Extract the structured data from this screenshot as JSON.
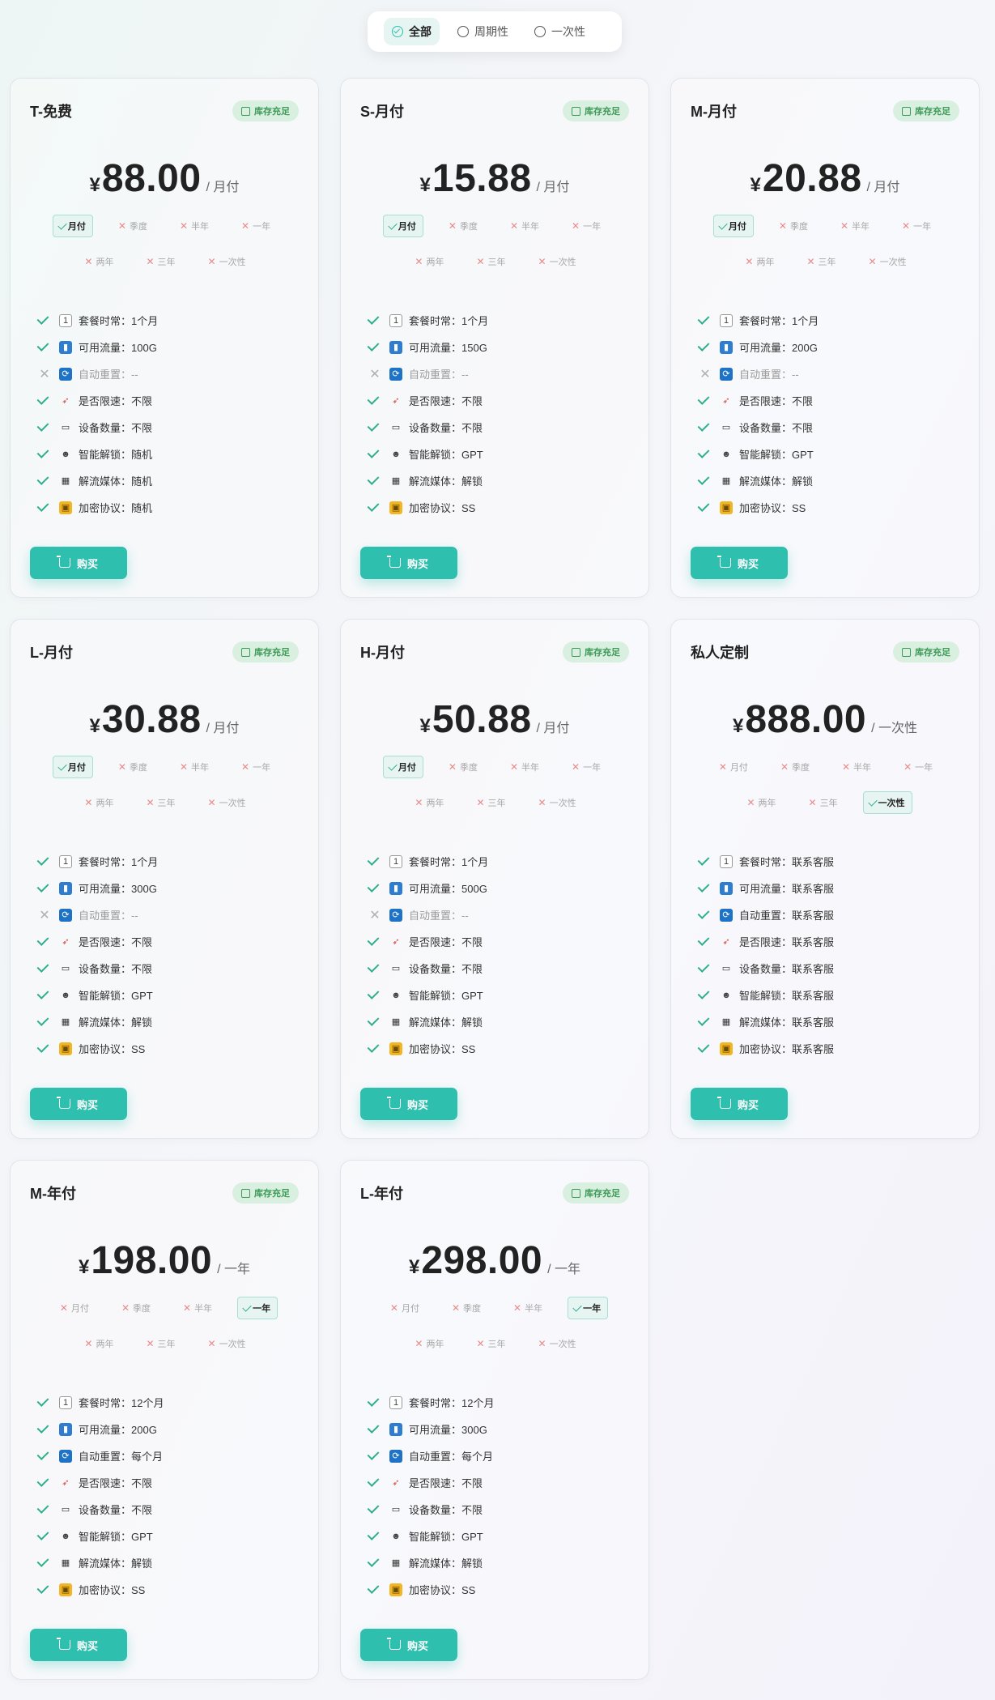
{
  "filter": {
    "options": [
      {
        "label": "全部",
        "active": true
      },
      {
        "label": "周期性",
        "active": false
      },
      {
        "label": "一次性",
        "active": false
      }
    ]
  },
  "plans": [
    {
      "name": "T-免费",
      "stock": "库存充足",
      "currency": "¥",
      "price": "88.00",
      "unit": "/ 月付",
      "periods": [
        {
          "label": "月付",
          "on": true
        },
        {
          "label": "季度",
          "on": false
        },
        {
          "label": "半年",
          "on": false
        },
        {
          "label": "一年",
          "on": false
        },
        {
          "label": "两年",
          "on": false
        },
        {
          "label": "三年",
          "on": false
        },
        {
          "label": "一次性",
          "on": false
        }
      ],
      "features": [
        {
          "icon": "calendar-icon",
          "text": "套餐时常：1个月",
          "ok": true
        },
        {
          "icon": "chart-icon",
          "text": "可用流量：100G",
          "ok": true
        },
        {
          "icon": "refresh-icon",
          "text": "自动重置：--",
          "ok": false
        },
        {
          "icon": "rocket-icon",
          "text": "是否限速：不限",
          "ok": true
        },
        {
          "icon": "laptop-icon",
          "text": "设备数量：不限",
          "ok": true
        },
        {
          "icon": "robot-icon",
          "text": "智能解锁：随机",
          "ok": true
        },
        {
          "icon": "clapper-icon",
          "text": "解流媒体：随机",
          "ok": true
        },
        {
          "icon": "lock-icon",
          "text": "加密协议：随机",
          "ok": true
        }
      ],
      "buy_label": "购买"
    },
    {
      "name": "S-月付",
      "stock": "库存充足",
      "currency": "¥",
      "price": "15.88",
      "unit": "/ 月付",
      "periods": [
        {
          "label": "月付",
          "on": true
        },
        {
          "label": "季度",
          "on": false
        },
        {
          "label": "半年",
          "on": false
        },
        {
          "label": "一年",
          "on": false
        },
        {
          "label": "两年",
          "on": false
        },
        {
          "label": "三年",
          "on": false
        },
        {
          "label": "一次性",
          "on": false
        }
      ],
      "features": [
        {
          "icon": "calendar-icon",
          "text": "套餐时常：1个月",
          "ok": true
        },
        {
          "icon": "chart-icon",
          "text": "可用流量：150G",
          "ok": true
        },
        {
          "icon": "refresh-icon",
          "text": "自动重置：--",
          "ok": false
        },
        {
          "icon": "rocket-icon",
          "text": "是否限速：不限",
          "ok": true
        },
        {
          "icon": "laptop-icon",
          "text": "设备数量：不限",
          "ok": true
        },
        {
          "icon": "robot-icon",
          "text": "智能解锁：GPT",
          "ok": true
        },
        {
          "icon": "clapper-icon",
          "text": "解流媒体：解锁",
          "ok": true
        },
        {
          "icon": "lock-icon",
          "text": "加密协议：SS",
          "ok": true
        }
      ],
      "buy_label": "购买"
    },
    {
      "name": "M-月付",
      "stock": "库存充足",
      "currency": "¥",
      "price": "20.88",
      "unit": "/ 月付",
      "periods": [
        {
          "label": "月付",
          "on": true
        },
        {
          "label": "季度",
          "on": false
        },
        {
          "label": "半年",
          "on": false
        },
        {
          "label": "一年",
          "on": false
        },
        {
          "label": "两年",
          "on": false
        },
        {
          "label": "三年",
          "on": false
        },
        {
          "label": "一次性",
          "on": false
        }
      ],
      "features": [
        {
          "icon": "calendar-icon",
          "text": "套餐时常：1个月",
          "ok": true
        },
        {
          "icon": "chart-icon",
          "text": "可用流量：200G",
          "ok": true
        },
        {
          "icon": "refresh-icon",
          "text": "自动重置：--",
          "ok": false
        },
        {
          "icon": "rocket-icon",
          "text": "是否限速：不限",
          "ok": true
        },
        {
          "icon": "laptop-icon",
          "text": "设备数量：不限",
          "ok": true
        },
        {
          "icon": "robot-icon",
          "text": "智能解锁：GPT",
          "ok": true
        },
        {
          "icon": "clapper-icon",
          "text": "解流媒体：解锁",
          "ok": true
        },
        {
          "icon": "lock-icon",
          "text": "加密协议：SS",
          "ok": true
        }
      ],
      "buy_label": "购买"
    },
    {
      "name": "L-月付",
      "stock": "库存充足",
      "currency": "¥",
      "price": "30.88",
      "unit": "/ 月付",
      "periods": [
        {
          "label": "月付",
          "on": true
        },
        {
          "label": "季度",
          "on": false
        },
        {
          "label": "半年",
          "on": false
        },
        {
          "label": "一年",
          "on": false
        },
        {
          "label": "两年",
          "on": false
        },
        {
          "label": "三年",
          "on": false
        },
        {
          "label": "一次性",
          "on": false
        }
      ],
      "features": [
        {
          "icon": "calendar-icon",
          "text": "套餐时常：1个月",
          "ok": true
        },
        {
          "icon": "chart-icon",
          "text": "可用流量：300G",
          "ok": true
        },
        {
          "icon": "refresh-icon",
          "text": "自动重置：--",
          "ok": false
        },
        {
          "icon": "rocket-icon",
          "text": "是否限速：不限",
          "ok": true
        },
        {
          "icon": "laptop-icon",
          "text": "设备数量：不限",
          "ok": true
        },
        {
          "icon": "robot-icon",
          "text": "智能解锁：GPT",
          "ok": true
        },
        {
          "icon": "clapper-icon",
          "text": "解流媒体：解锁",
          "ok": true
        },
        {
          "icon": "lock-icon",
          "text": "加密协议：SS",
          "ok": true
        }
      ],
      "buy_label": "购买"
    },
    {
      "name": "H-月付",
      "stock": "库存充足",
      "currency": "¥",
      "price": "50.88",
      "unit": "/ 月付",
      "periods": [
        {
          "label": "月付",
          "on": true
        },
        {
          "label": "季度",
          "on": false
        },
        {
          "label": "半年",
          "on": false
        },
        {
          "label": "一年",
          "on": false
        },
        {
          "label": "两年",
          "on": false
        },
        {
          "label": "三年",
          "on": false
        },
        {
          "label": "一次性",
          "on": false
        }
      ],
      "features": [
        {
          "icon": "calendar-icon",
          "text": "套餐时常：1个月",
          "ok": true
        },
        {
          "icon": "chart-icon",
          "text": "可用流量：500G",
          "ok": true
        },
        {
          "icon": "refresh-icon",
          "text": "自动重置：--",
          "ok": false
        },
        {
          "icon": "rocket-icon",
          "text": "是否限速：不限",
          "ok": true
        },
        {
          "icon": "laptop-icon",
          "text": "设备数量：不限",
          "ok": true
        },
        {
          "icon": "robot-icon",
          "text": "智能解锁：GPT",
          "ok": true
        },
        {
          "icon": "clapper-icon",
          "text": "解流媒体：解锁",
          "ok": true
        },
        {
          "icon": "lock-icon",
          "text": "加密协议：SS",
          "ok": true
        }
      ],
      "buy_label": "购买"
    },
    {
      "name": "私人定制",
      "stock": "库存充足",
      "currency": "¥",
      "price": "888.00",
      "unit": "/ 一次性",
      "periods": [
        {
          "label": "月付",
          "on": false
        },
        {
          "label": "季度",
          "on": false
        },
        {
          "label": "半年",
          "on": false
        },
        {
          "label": "一年",
          "on": false
        },
        {
          "label": "两年",
          "on": false
        },
        {
          "label": "三年",
          "on": false
        },
        {
          "label": "一次性",
          "on": true
        }
      ],
      "features": [
        {
          "icon": "calendar-icon",
          "text": "套餐时常：联系客服",
          "ok": true
        },
        {
          "icon": "chart-icon",
          "text": "可用流量：联系客服",
          "ok": true
        },
        {
          "icon": "refresh-icon",
          "text": "自动重置：联系客服",
          "ok": true
        },
        {
          "icon": "rocket-icon",
          "text": "是否限速：联系客服",
          "ok": true
        },
        {
          "icon": "laptop-icon",
          "text": "设备数量：联系客服",
          "ok": true
        },
        {
          "icon": "robot-icon",
          "text": "智能解锁：联系客服",
          "ok": true
        },
        {
          "icon": "clapper-icon",
          "text": "解流媒体：联系客服",
          "ok": true
        },
        {
          "icon": "lock-icon",
          "text": "加密协议：联系客服",
          "ok": true
        }
      ],
      "buy_label": "购买"
    },
    {
      "name": "M-年付",
      "stock": "库存充足",
      "currency": "¥",
      "price": "198.00",
      "unit": "/ 一年",
      "periods": [
        {
          "label": "月付",
          "on": false
        },
        {
          "label": "季度",
          "on": false
        },
        {
          "label": "半年",
          "on": false
        },
        {
          "label": "一年",
          "on": true
        },
        {
          "label": "两年",
          "on": false
        },
        {
          "label": "三年",
          "on": false
        },
        {
          "label": "一次性",
          "on": false
        }
      ],
      "features": [
        {
          "icon": "calendar-icon",
          "text": "套餐时常：12个月",
          "ok": true
        },
        {
          "icon": "chart-icon",
          "text": "可用流量：200G",
          "ok": true
        },
        {
          "icon": "refresh-icon",
          "text": "自动重置：每个月",
          "ok": true
        },
        {
          "icon": "rocket-icon",
          "text": "是否限速：不限",
          "ok": true
        },
        {
          "icon": "laptop-icon",
          "text": "设备数量：不限",
          "ok": true
        },
        {
          "icon": "robot-icon",
          "text": "智能解锁：GPT",
          "ok": true
        },
        {
          "icon": "clapper-icon",
          "text": "解流媒体：解锁",
          "ok": true
        },
        {
          "icon": "lock-icon",
          "text": "加密协议：SS",
          "ok": true
        }
      ],
      "buy_label": "购买"
    },
    {
      "name": "L-年付",
      "stock": "库存充足",
      "currency": "¥",
      "price": "298.00",
      "unit": "/ 一年",
      "periods": [
        {
          "label": "月付",
          "on": false
        },
        {
          "label": "季度",
          "on": false
        },
        {
          "label": "半年",
          "on": false
        },
        {
          "label": "一年",
          "on": true
        },
        {
          "label": "两年",
          "on": false
        },
        {
          "label": "三年",
          "on": false
        },
        {
          "label": "一次性",
          "on": false
        }
      ],
      "features": [
        {
          "icon": "calendar-icon",
          "text": "套餐时常：12个月",
          "ok": true
        },
        {
          "icon": "chart-icon",
          "text": "可用流量：300G",
          "ok": true
        },
        {
          "icon": "refresh-icon",
          "text": "自动重置：每个月",
          "ok": true
        },
        {
          "icon": "rocket-icon",
          "text": "是否限速：不限",
          "ok": true
        },
        {
          "icon": "laptop-icon",
          "text": "设备数量：不限",
          "ok": true
        },
        {
          "icon": "robot-icon",
          "text": "智能解锁：GPT",
          "ok": true
        },
        {
          "icon": "clapper-icon",
          "text": "解流媒体：解锁",
          "ok": true
        },
        {
          "icon": "lock-icon",
          "text": "加密协议：SS",
          "ok": true
        }
      ],
      "buy_label": "购买"
    }
  ],
  "colors": {
    "accent": "#2fbfae",
    "stock_bg": "#d9efe0",
    "stock_text": "#3e9a57",
    "cross": "#e98a8a"
  }
}
